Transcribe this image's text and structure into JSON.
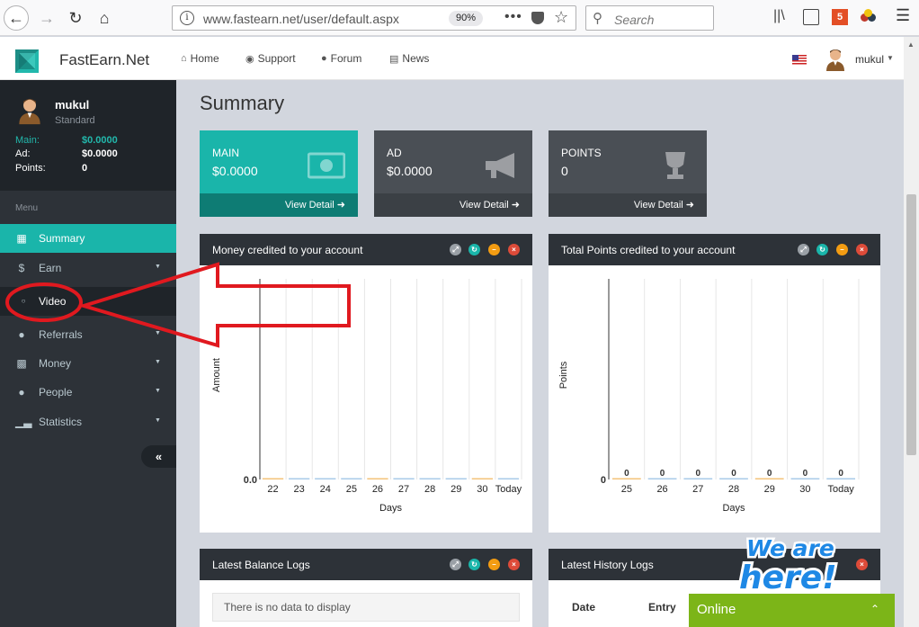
{
  "browser": {
    "url": "www.fastearn.net/user/default.aspx",
    "zoom": "90%",
    "search_placeholder": "Search"
  },
  "header": {
    "brand": "FastEarn.Net",
    "nav": [
      {
        "label": "Home",
        "icon": "home-icon"
      },
      {
        "label": "Support",
        "icon": "support-icon"
      },
      {
        "label": "Forum",
        "icon": "comments-icon"
      },
      {
        "label": "News",
        "icon": "newspaper-icon"
      }
    ],
    "username": "mukul"
  },
  "sidebar": {
    "user": {
      "name": "mukul",
      "role": "Standard"
    },
    "balances": [
      {
        "label": "Main:",
        "value": "$0.0000"
      },
      {
        "label": "Ad:",
        "value": "$0.0000"
      },
      {
        "label": "Points:",
        "value": "0"
      }
    ],
    "menu_heading": "Menu",
    "items": [
      {
        "label": "Summary",
        "icon": "dashboard-icon",
        "active": true
      },
      {
        "label": "Earn",
        "icon": "dollar-icon",
        "caret": true
      },
      {
        "label": "Video",
        "icon": "circle-icon",
        "sub": true
      },
      {
        "label": "Referrals",
        "icon": "users-icon",
        "caret": true
      },
      {
        "label": "Money",
        "icon": "money-icon",
        "caret": true
      },
      {
        "label": "People",
        "icon": "comments-icon",
        "caret": true
      },
      {
        "label": "Statistics",
        "icon": "bar-chart-icon",
        "caret": true
      }
    ],
    "collapse_label": "«"
  },
  "main": {
    "title": "Summary",
    "stat_boxes": [
      {
        "title": "MAIN",
        "value": "$0.0000",
        "footer": "View Detail",
        "icon": "money-bill-icon"
      },
      {
        "title": "AD",
        "value": "$0.0000",
        "footer": "View Detail",
        "icon": "megaphone-icon"
      },
      {
        "title": "POINTS",
        "value": "0",
        "footer": "View Detail",
        "icon": "trophy-icon"
      }
    ],
    "panels": {
      "money": "Money credited to your account",
      "points": "Total Points credited to your account",
      "balance_logs": "Latest Balance Logs",
      "history_logs": "Latest History Logs"
    },
    "balance_logs_empty": "There is no data to display",
    "history_columns": [
      "Date",
      "Entry"
    ]
  },
  "chart_data": [
    {
      "type": "bar",
      "ylabel": "Amount",
      "xlabel": "Days",
      "categories": [
        "22",
        "23",
        "24",
        "25",
        "26",
        "27",
        "28",
        "29",
        "30",
        "Today"
      ],
      "values": [
        0,
        0,
        0,
        0,
        0,
        0,
        0,
        0,
        0,
        0
      ],
      "y_tick_labels": [
        "0.0"
      ],
      "grid": true
    },
    {
      "type": "bar",
      "ylabel": "Points",
      "xlabel": "Days",
      "categories": [
        "25",
        "26",
        "27",
        "28",
        "29",
        "30",
        "Today"
      ],
      "values": [
        0,
        0,
        0,
        0,
        0,
        0,
        0
      ],
      "data_labels": [
        "0",
        "0",
        "0",
        "0",
        "0",
        "0",
        "0"
      ],
      "y_tick_labels": [
        "0"
      ],
      "grid": true
    }
  ],
  "widgets": {
    "online": "Online",
    "we_are_here": "We are here!"
  },
  "colors": {
    "accent": "#1ab5aa",
    "sidebar": "#2d3238",
    "annotation": "#e0191f",
    "online": "#7cb518"
  }
}
